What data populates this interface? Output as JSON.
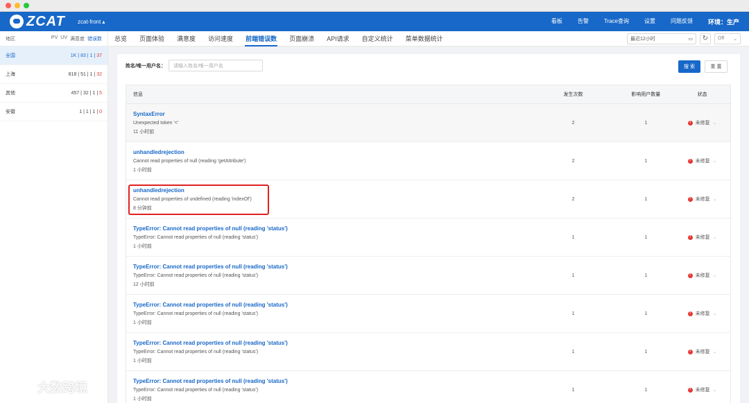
{
  "header": {
    "logo": "ZCAT",
    "project": "zcat-front",
    "nav": [
      "看板",
      "告警",
      "Trace查询",
      "设置",
      "问题反馈"
    ],
    "env": "环境：生产"
  },
  "left": {
    "title": "地区",
    "cols": [
      "PV",
      "UV",
      "满意度",
      "错误数"
    ],
    "regions": [
      {
        "name": "全国",
        "pv": "1K",
        "uv": "83",
        "sat": "1",
        "err": "37"
      },
      {
        "name": "上海",
        "pv": "818",
        "uv": "51",
        "sat": "1",
        "err": "32"
      },
      {
        "name": "其他",
        "pv": "457",
        "uv": "32",
        "sat": "1",
        "err": "5"
      },
      {
        "name": "安徽",
        "pv": "1",
        "uv": "1",
        "sat": "1",
        "err": "0"
      }
    ]
  },
  "tabs": [
    "总览",
    "页面体验",
    "满意度",
    "访问速度",
    "前端错误数",
    "页面崩溃",
    "API请求",
    "自定义统计",
    "菜单数据统计"
  ],
  "tools": {
    "time_range": "最近12小时",
    "off": "Off"
  },
  "filter": {
    "label": "姓名/唯一用户名：",
    "placeholder": "请输入姓名/唯一用户名",
    "search": "搜 索",
    "reset": "重 置"
  },
  "table": {
    "headers": {
      "info": "信息",
      "count": "发生次数",
      "users": "影响用户数量",
      "status": "状态"
    },
    "rows": [
      {
        "title": "SyntaxError",
        "msg": "Unexpected token '<'",
        "time": "11 小时前",
        "count": "2",
        "users": "1",
        "status": "未修复"
      },
      {
        "title": "unhandledrejection",
        "msg": "Cannot read properties of null (reading 'getAttribute')",
        "time": "1 小时前",
        "count": "2",
        "users": "1",
        "status": "未修复"
      },
      {
        "title": "unhandledrejection",
        "msg": "Cannot read properties of undefined (reading 'indexOf')",
        "time": "8 分钟前",
        "count": "2",
        "users": "1",
        "status": "未修复"
      },
      {
        "title": "TypeError: Cannot read properties of null (reading 'status')",
        "msg": "TypeError: Cannot read properties of null (reading 'status')",
        "time": "1 小时前",
        "count": "1",
        "users": "1",
        "status": "未修复"
      },
      {
        "title": "TypeError: Cannot read properties of null (reading 'status')",
        "msg": "TypeError: Cannot read properties of null (reading 'status')",
        "time": "12 小时前",
        "count": "1",
        "users": "1",
        "status": "未修复"
      },
      {
        "title": "TypeError: Cannot read properties of null (reading 'status')",
        "msg": "TypeError: Cannot read properties of null (reading 'status')",
        "time": "1 小时前",
        "count": "1",
        "users": "1",
        "status": "未修复"
      },
      {
        "title": "TypeError: Cannot read properties of null (reading 'status')",
        "msg": "TypeError: Cannot read properties of null (reading 'status')",
        "time": "1 小时前",
        "count": "1",
        "users": "1",
        "status": "未修复"
      },
      {
        "title": "TypeError: Cannot read properties of null (reading 'status')",
        "msg": "TypeError: Cannot read properties of null (reading 'status')",
        "time": "1 小时前",
        "count": "1",
        "users": "1",
        "status": "未修复"
      }
    ]
  },
  "watermark": "大数跨境"
}
